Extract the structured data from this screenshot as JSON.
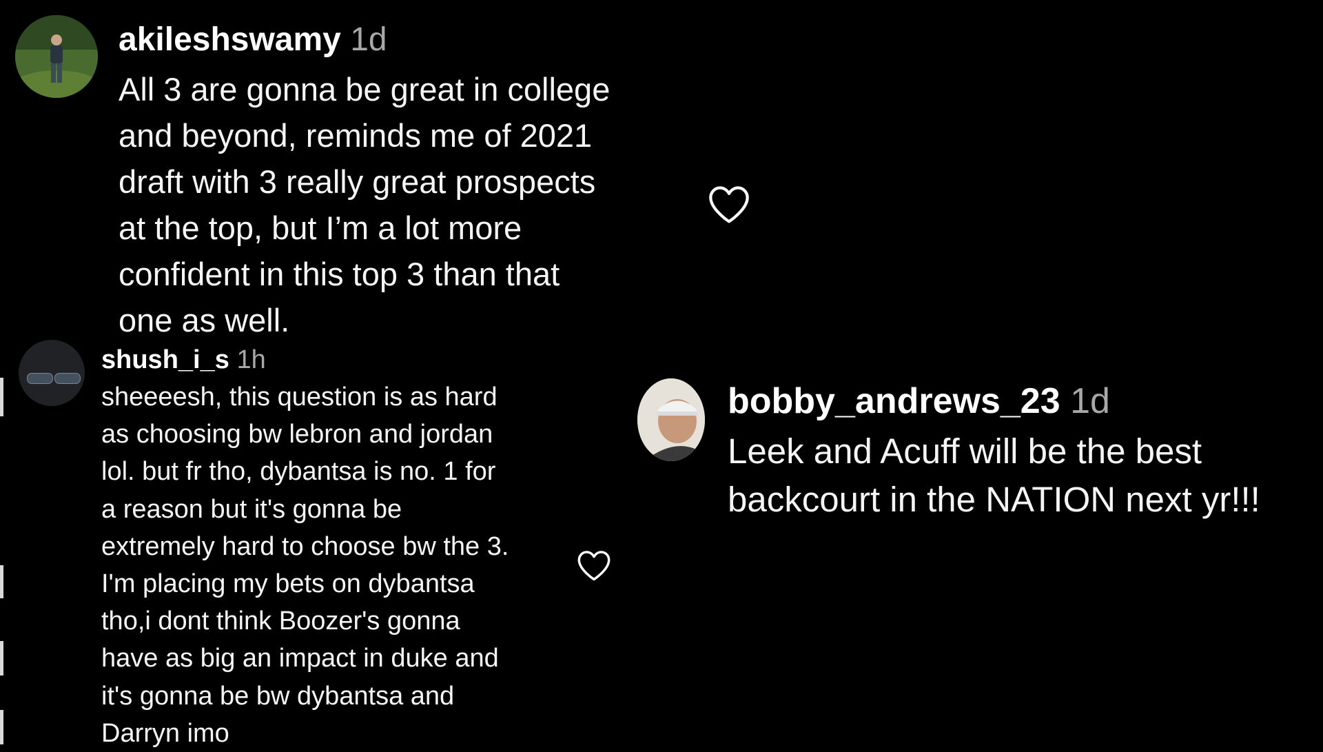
{
  "comments": [
    {
      "username": "akileshswamy",
      "time": "1d",
      "lines": [
        "All 3 are gonna be great in college",
        "and beyond, reminds me of 2021",
        "draft with 3 really great prospects",
        "at the top, but I’m a lot more",
        "confident in this top 3 than that",
        "one as well."
      ],
      "like_icon": "heart-outline-icon"
    },
    {
      "username": "shush_i_s",
      "time": "1h",
      "lines": [
        "sheeeesh, this question is as hard",
        "as choosing bw lebron and jordan",
        "lol. but fr tho, dybantsa is no. 1 for",
        "a reason but it's gonna be",
        "extremely hard to choose bw the 3.",
        "I'm placing my bets on dybantsa",
        "tho,i dont think Boozer's gonna",
        "have as big an impact in duke and",
        "it's gonna be bw dybantsa and",
        "Darryn imo"
      ],
      "like_icon": "heart-outline-icon"
    },
    {
      "username": "bobby_andrews_23",
      "time": "1d",
      "lines": [
        "Leek and Acuff will be the best",
        "backcourt in the NATION next yr!!!"
      ]
    }
  ],
  "colors": {
    "background": "#000000",
    "text": "#ffffff",
    "timestamp": "#a8a8a8"
  }
}
